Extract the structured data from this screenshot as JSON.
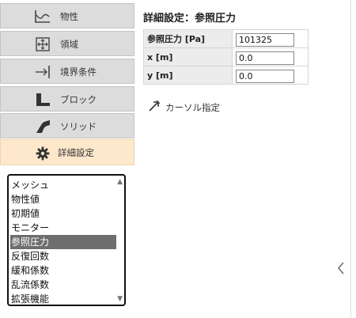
{
  "sidebar": {
    "items": [
      {
        "label": "物性",
        "icon": "property-graph-icon"
      },
      {
        "label": "領域",
        "icon": "domain-expand-icon"
      },
      {
        "label": "境界条件",
        "icon": "boundary-arrow-icon"
      },
      {
        "label": "ブロック",
        "icon": "block-icon"
      },
      {
        "label": "ソリッド",
        "icon": "solid-icon"
      },
      {
        "label": "詳細設定",
        "icon": "gear-icon"
      }
    ],
    "active_index": 5
  },
  "list": {
    "items": [
      "メッシュ",
      "物性値",
      "初期値",
      "モニター",
      "参照圧力",
      "反復回数",
      "緩和係数",
      "乱流係数",
      "拡張機能"
    ],
    "selected": "参照圧力"
  },
  "panel": {
    "title": "詳細設定：参照圧力",
    "rows": [
      {
        "label": "参照圧力 [Pa]",
        "value": "101325"
      },
      {
        "label": "x [m]",
        "value": "0.0"
      },
      {
        "label": "y [m]",
        "value": "0.0"
      }
    ],
    "cursor_label": "カーソル指定"
  },
  "colors": {
    "active_tab": "#fde8cc",
    "tab_background": "#dcdcdc",
    "selected_item": "#6e6e6e"
  }
}
